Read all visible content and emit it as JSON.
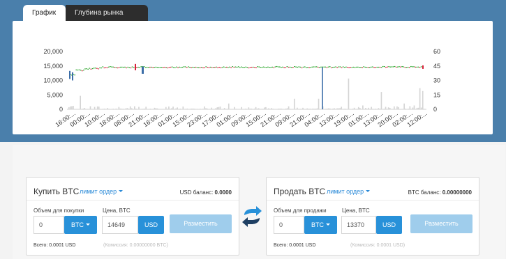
{
  "tabs": [
    {
      "label": "График",
      "active": true
    },
    {
      "label": "Глубина рынка",
      "active": false
    }
  ],
  "chart_data": {
    "type": "candlestick",
    "y_left": {
      "range": [
        0,
        20000
      ],
      "ticks": [
        "20,000",
        "15,000",
        "10,000",
        "5,000",
        "0"
      ]
    },
    "y_right": {
      "range": [
        0,
        60
      ],
      "ticks": [
        "60",
        "45",
        "30",
        "15",
        "0"
      ]
    },
    "x_ticks": [
      "16:00:...",
      "00:00:...",
      "10:00:...",
      "18:00:...",
      "08:00:...",
      "21:00:...",
      "16:00:...",
      "01:00:...",
      "15:00:...",
      "23:00:...",
      "17:00:...",
      "01:00:...",
      "09:00:...",
      "15:00:...",
      "21:00:...",
      "09:00:...",
      "21:00:...",
      "04:00:...",
      "13:00:...",
      "19:00:...",
      "01:00:...",
      "13:00:...",
      "20:00:...",
      "02:00:...",
      "12:00:..."
    ],
    "price_level_approx": 14600,
    "price_low_spike_approx": 0,
    "series_colors": {
      "up": "#2aa52a",
      "down": "#d8203a",
      "spike": "#3c6ea8",
      "volume": "#d4d4d4"
    }
  },
  "buy": {
    "title": "Купить BTC",
    "order_type": "лимит ордер",
    "balance_label": "USD баланс:",
    "balance_value": "0.0000",
    "amount_label": "Объем для покупки",
    "amount_value": "0",
    "amount_currency": "BTC",
    "price_label": "Цена, BTC",
    "price_value": "14649",
    "price_currency": "USD",
    "submit": "Разместить",
    "total": "Всего: 0.0001 USD",
    "commission": "(Комиссия: 0.00000000 BTC)"
  },
  "sell": {
    "title": "Продать BTC",
    "order_type": "лимит ордер",
    "balance_label": "BTC баланс:",
    "balance_value": "0.00000000",
    "amount_label": "Объем для продажи",
    "amount_value": "0",
    "amount_currency": "BTC",
    "price_label": "Цена, BTC",
    "price_value": "13370",
    "price_currency": "USD",
    "submit": "Разместить",
    "total": "Всего: 0.0001 USD",
    "commission": "(Комиссия: 0.0001 USD)"
  },
  "icons": {
    "swap": "swap-arrows-icon",
    "caret": "caret-down-icon"
  },
  "colors": {
    "band": "#4a7fab",
    "accent": "#2891d9",
    "button_disabled": "#9fcdec"
  }
}
